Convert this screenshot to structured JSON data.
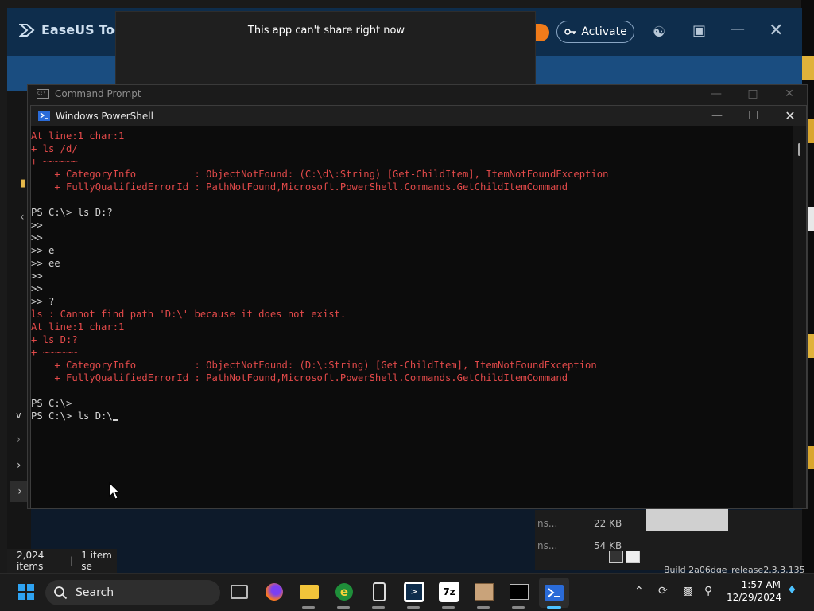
{
  "easeus": {
    "app_name": "EaseUS Todo",
    "activate_label": "Activate",
    "status_items_count": "2,024 items",
    "status_selected": "1 item se",
    "file_size_1": "22 KB",
    "file_size_2": "54 KB",
    "name_frag_1": "ns...",
    "name_frag_2": "ns...",
    "build_text": "Build 2a06dge_release2.3.3.135"
  },
  "share_dialog": {
    "message": "This app can't share right now"
  },
  "cmd_window": {
    "title": "Command Prompt"
  },
  "powershell": {
    "title": "Windows PowerShell",
    "lines": [
      {
        "text": "At line:1 char:1",
        "type": "err"
      },
      {
        "text": "+ ls /d/",
        "type": "err"
      },
      {
        "text": "+ ~~~~~~",
        "type": "err"
      },
      {
        "text": "    + CategoryInfo          : ObjectNotFound: (C:\\d\\:String) [Get-ChildItem], ItemNotFoundException",
        "type": "err"
      },
      {
        "text": "    + FullyQualifiedErrorId : PathNotFound,Microsoft.PowerShell.Commands.GetChildItemCommand",
        "type": "err"
      },
      {
        "text": "",
        "type": "norm"
      },
      {
        "text": "PS C:\\> ls D:?",
        "type": "norm"
      },
      {
        "text": ">>",
        "type": "norm"
      },
      {
        "text": ">>",
        "type": "norm"
      },
      {
        "text": ">> e",
        "type": "norm"
      },
      {
        "text": ">> ee",
        "type": "norm"
      },
      {
        "text": ">>",
        "type": "norm"
      },
      {
        "text": ">>",
        "type": "norm"
      },
      {
        "text": ">> ?",
        "type": "norm"
      },
      {
        "text": "ls : Cannot find path 'D:\\' because it does not exist.",
        "type": "err"
      },
      {
        "text": "At line:1 char:1",
        "type": "err"
      },
      {
        "text": "+ ls D:?",
        "type": "err"
      },
      {
        "text": "+ ~~~~~~",
        "type": "err"
      },
      {
        "text": "    + CategoryInfo          : ObjectNotFound: (D:\\:String) [Get-ChildItem], ItemNotFoundException",
        "type": "err"
      },
      {
        "text": "    + FullyQualifiedErrorId : PathNotFound,Microsoft.PowerShell.Commands.GetChildItemCommand",
        "type": "err"
      },
      {
        "text": "",
        "type": "norm"
      },
      {
        "text": "PS C:\\>",
        "type": "norm"
      }
    ],
    "current_prompt": "PS C:\\> ls D:\\"
  },
  "taskbar": {
    "search_label": "Search",
    "time": "1:57 AM",
    "date": "12/29/2024"
  },
  "colors": {
    "console_error": "#e34a4a",
    "console_text": "#d4d4d4",
    "easeus_accent": "#f07b1a"
  }
}
